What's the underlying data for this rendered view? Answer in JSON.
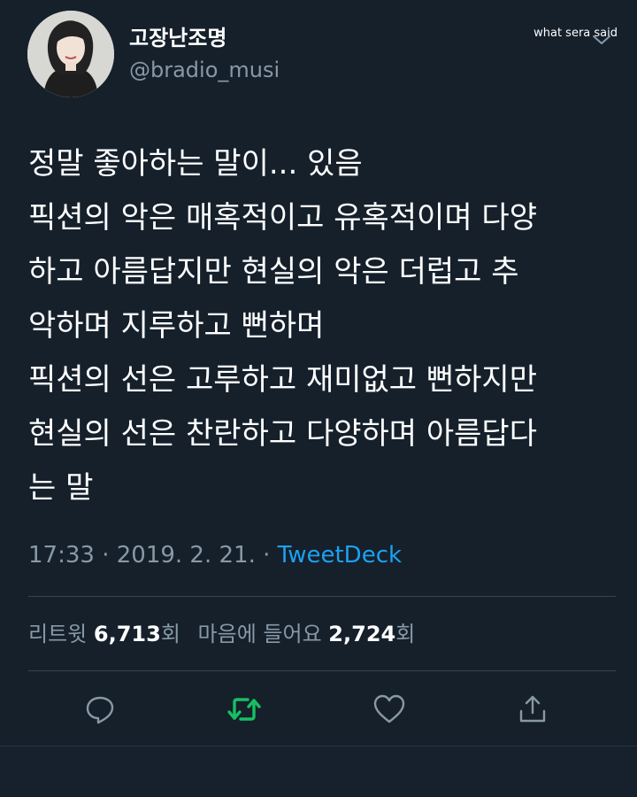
{
  "author": {
    "display_name": "고장난조명",
    "handle": "@bradio_musi"
  },
  "watermark": "what sera said",
  "tweet": {
    "lines": [
      "정말 좋아하는 말이... 있음",
      "픽션의 악은 매혹적이고 유혹적이며 다양",
      "하고 아름답지만 현실의 악은 더럽고 추",
      "악하며 지루하고 뻔하며",
      "픽션의 선은 고루하고 재미없고 뻔하지만",
      "현실의 선은 찬란하고 다양하며 아름답다",
      "는 말"
    ],
    "time": "17:33",
    "date": "2019. 2. 21.",
    "separator": "·",
    "source": "TweetDeck"
  },
  "stats": {
    "retweets_label": "리트윗",
    "retweets": "6,713",
    "retweets_unit": "회",
    "likes_label": "마음에 들어요",
    "likes": "2,724",
    "likes_unit": "회"
  },
  "actions": {
    "reply_icon": "reply-icon",
    "retweet_icon": "retweet-icon",
    "like_icon": "heart-icon",
    "share_icon": "share-icon"
  },
  "colors": {
    "background": "#15202b",
    "secondary_text": "#8899a6",
    "link": "#1da1f2",
    "retweet_active": "#17bf63",
    "divider": "#38444d"
  }
}
